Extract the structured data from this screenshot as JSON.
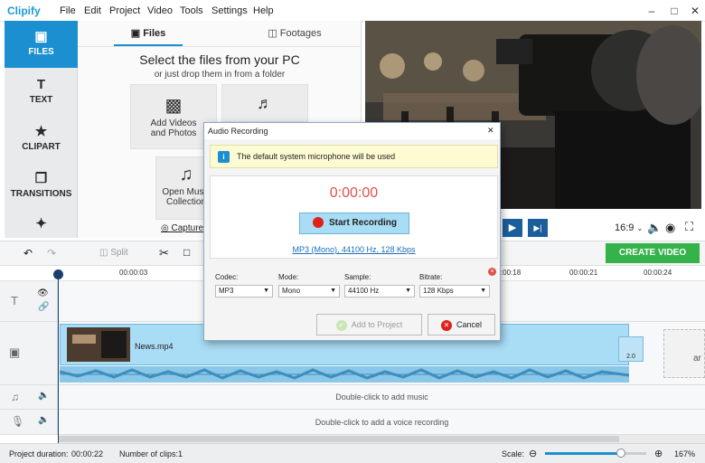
{
  "app": {
    "name": "Clipify"
  },
  "menu": [
    "File",
    "Edit",
    "Project",
    "Video",
    "Tools",
    "Settings",
    "Help"
  ],
  "sidebar": {
    "items": [
      {
        "label": "FILES",
        "icon": "image-icon"
      },
      {
        "label": "TEXT",
        "icon": "text-icon"
      },
      {
        "label": "CLIPART",
        "icon": "star-icon"
      },
      {
        "label": "TRANSITIONS",
        "icon": "transitions-icon"
      },
      {
        "label": "",
        "icon": "magic-wand-icon"
      }
    ]
  },
  "files_panel": {
    "tabs": [
      "Files",
      "Footages"
    ],
    "heading": "Select the files from your PC",
    "subheading": "or just drop them in from a folder",
    "tiles": [
      "Add Videos and Photos",
      "",
      "Open Music Collection"
    ],
    "capture_label": "Capture"
  },
  "player": {
    "aspect": "16:9"
  },
  "toolbar": {
    "split_label": "Split",
    "create_label": "CREATE VIDEO"
  },
  "timeline": {
    "ticks": [
      "00:00:03",
      "00:00:18",
      "00:00:21",
      "00:00:24"
    ],
    "clip_name": "News.mp4",
    "thumb_label": "2.0",
    "music_hint": "Double-click to add music",
    "voice_hint": "Double-click to add a voice recording",
    "placeholder_label": "ar"
  },
  "dialog": {
    "title": "Audio Recording",
    "info": "The default system microphone will be used",
    "timer": "0:00:00",
    "start_label": "Start Recording",
    "format_link": "MP3 (Mono), 44100 Hz, 128 Kbps",
    "fields": [
      {
        "label": "Codec:",
        "value": "MP3"
      },
      {
        "label": "Mode:",
        "value": "Mono"
      },
      {
        "label": "Sample:",
        "value": "44100 Hz"
      },
      {
        "label": "Bitrate:",
        "value": "128 Kbps"
      }
    ],
    "add_label": "Add to Project",
    "cancel_label": "Cancel"
  },
  "status": {
    "duration_label": "Project duration:",
    "duration": "00:00:22",
    "clips_label": "Number of clips:",
    "clips": "1",
    "scale_label": "Scale:",
    "zoom": "167%",
    "scale_level": 0.75
  },
  "colors": {
    "accent": "#1c8fd0",
    "create": "#35b34a",
    "record": "#e0201a",
    "timer": "#e0504a"
  }
}
